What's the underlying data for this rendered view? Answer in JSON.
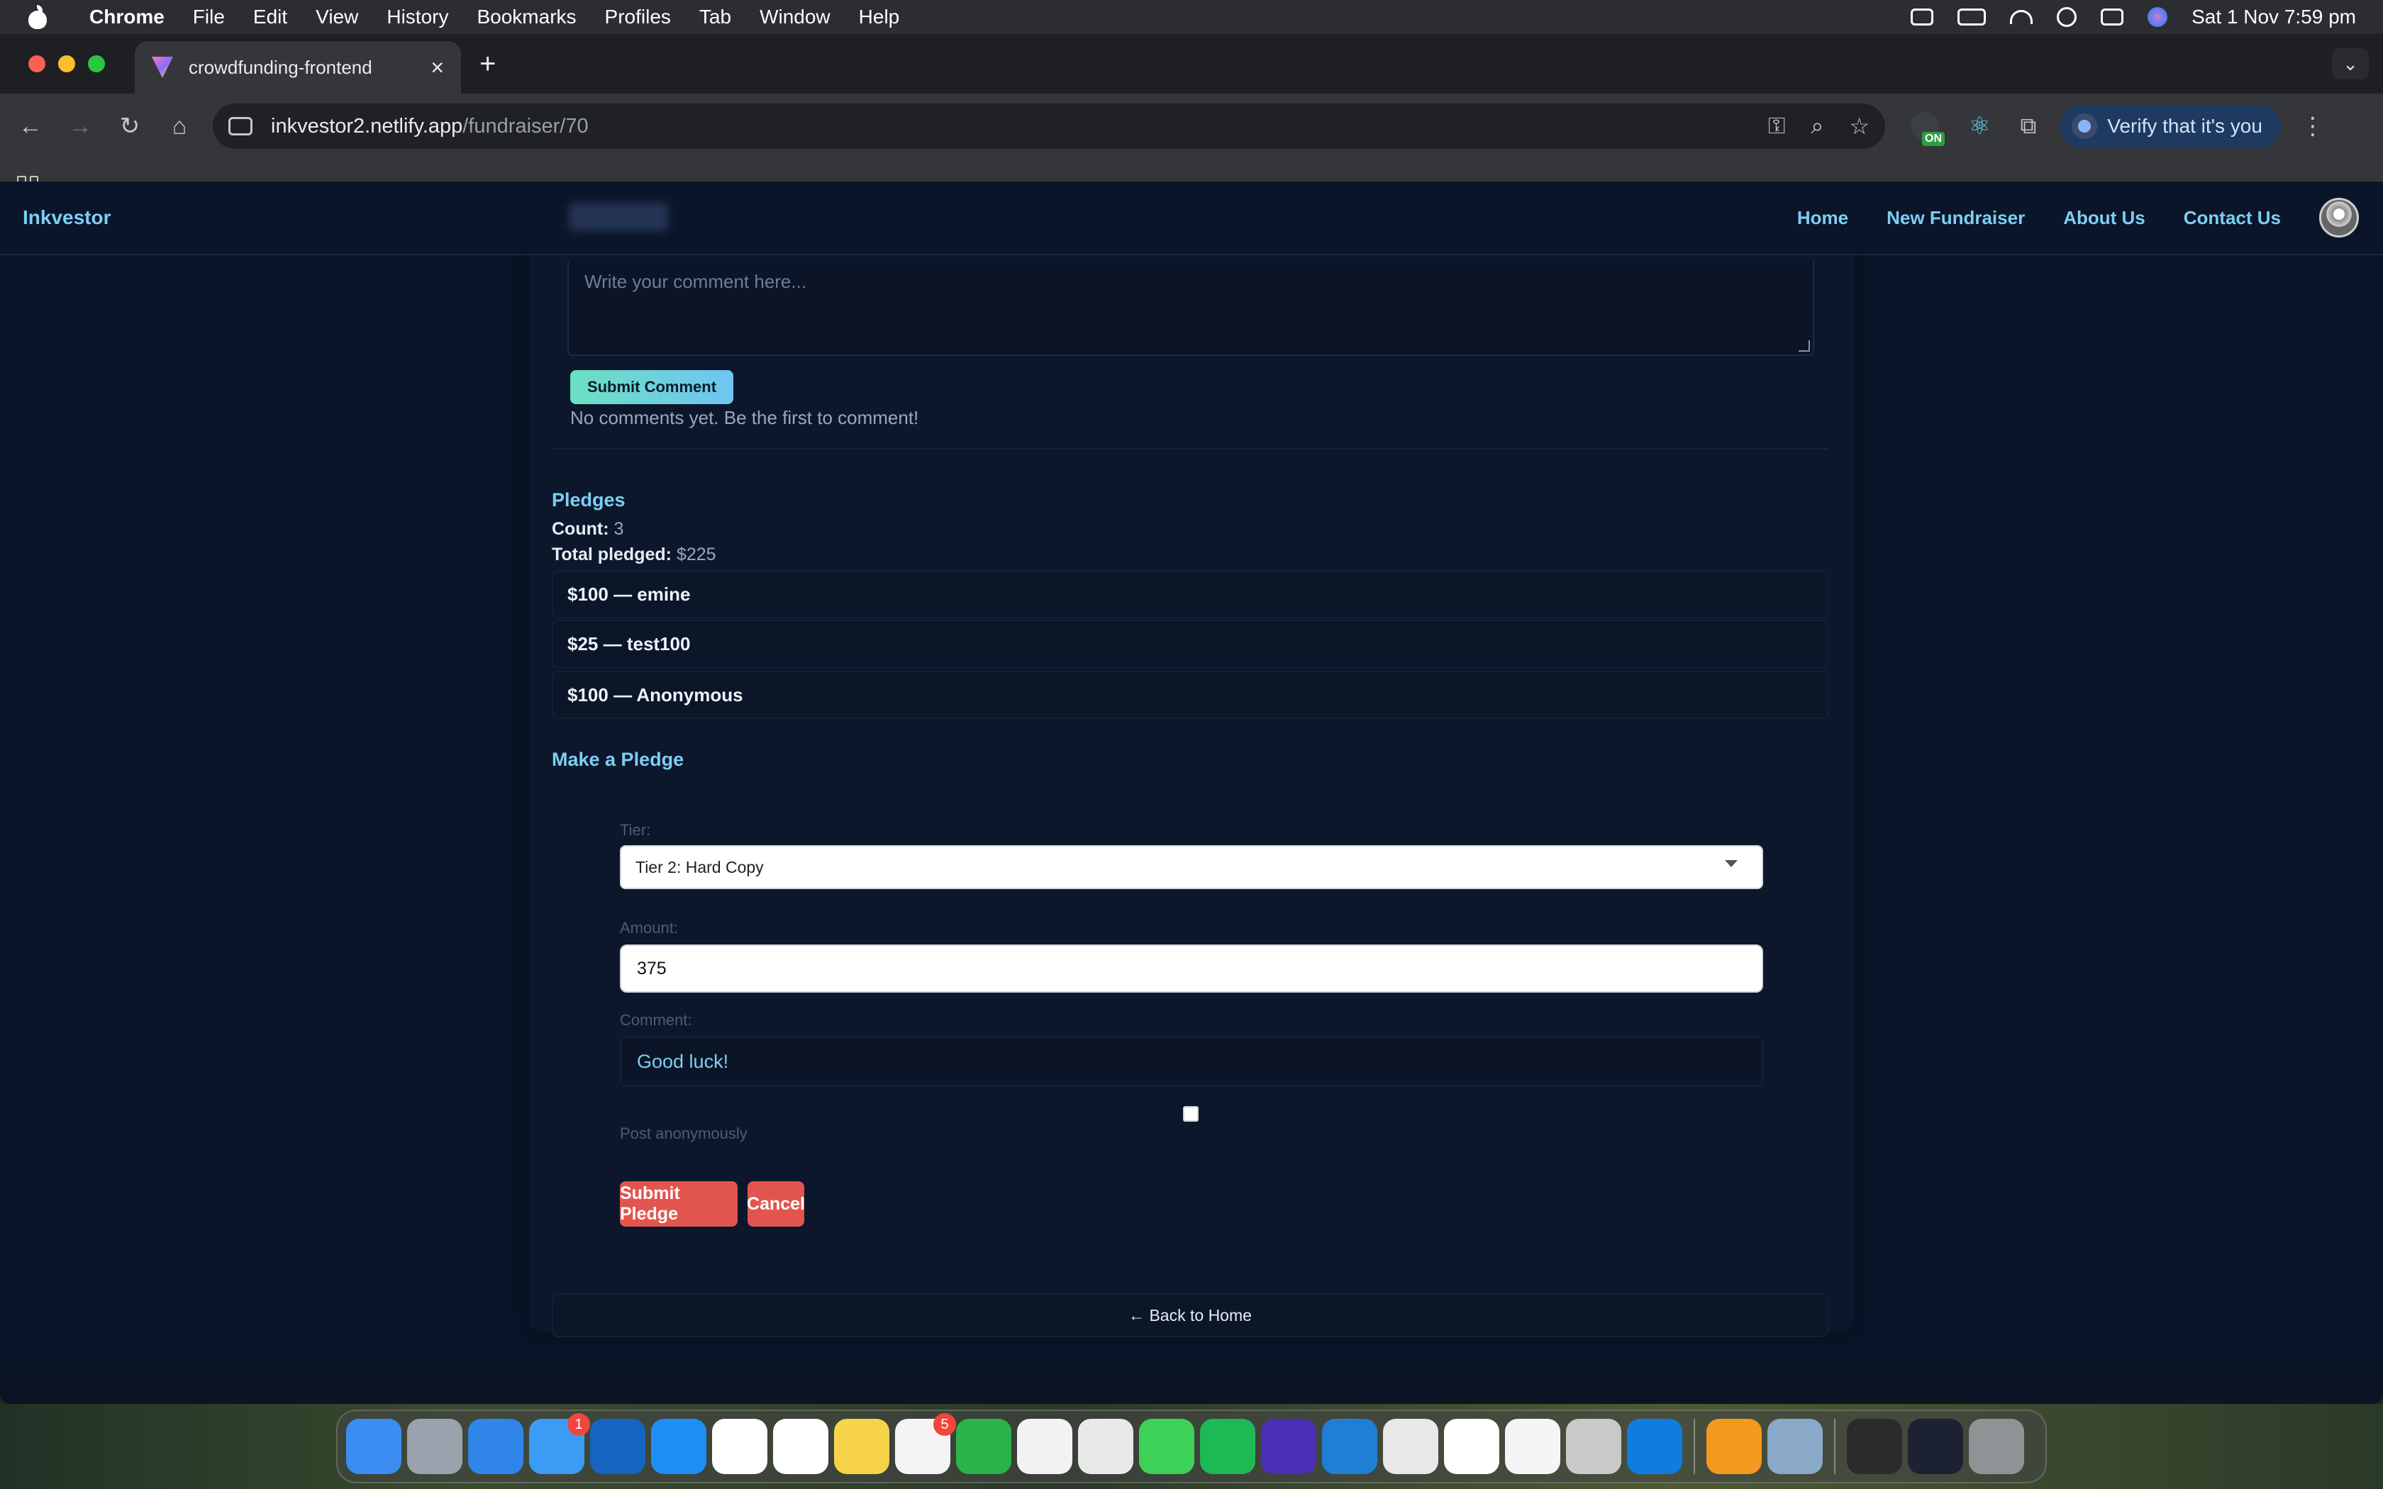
{
  "menubar": {
    "app_name": "Chrome",
    "items": [
      "File",
      "Edit",
      "View",
      "History",
      "Bookmarks",
      "Profiles",
      "Tab",
      "Window",
      "Help"
    ],
    "clock": "Sat 1 Nov  7:59 pm"
  },
  "browser": {
    "tab_title": "crowdfunding-frontend",
    "url_host": "inkvestor2.netlify.app",
    "url_path": "/fundraiser/70",
    "verify_label": "Verify that it's you",
    "extension_badge": "ON"
  },
  "site": {
    "brand": "Inkvestor",
    "nav": [
      "Home",
      "New Fundraiser",
      "About Us",
      "Contact Us"
    ]
  },
  "comments": {
    "placeholder": "Write your comment here...",
    "submit_label": "Submit Comment",
    "empty_message": "No comments yet. Be the first to comment!"
  },
  "pledges": {
    "title": "Pledges",
    "count_label": "Count:",
    "count_value": "3",
    "total_label": "Total pledged:",
    "total_value": "$225",
    "items": [
      "$100 — emine",
      "$25 — test100",
      "$100 — Anonymous"
    ]
  },
  "pledge_form": {
    "title": "Make a Pledge",
    "tier_label": "Tier:",
    "tier_value": "Tier 2: Hard Copy",
    "amount_label": "Amount:",
    "amount_value": "375",
    "comment_label": "Comment:",
    "comment_value": "Good luck!",
    "anonymous_label": "Post anonymously",
    "submit_label": "Submit Pledge",
    "cancel_label": "Cancel"
  },
  "back_home": "← Back to Home",
  "dock": {
    "apps": [
      {
        "name": "finder",
        "color": "#3b8df1"
      },
      {
        "name": "launchpad",
        "color": "#9aa3ad"
      },
      {
        "name": "safari",
        "color": "#2f86e8"
      },
      {
        "name": "mail",
        "color": "#3a9cf4",
        "badge": "1"
      },
      {
        "name": "outlook",
        "color": "#1565c0"
      },
      {
        "name": "app-store",
        "color": "#1e8ef7"
      },
      {
        "name": "notion",
        "color": "#ffffff"
      },
      {
        "name": "calendar",
        "color": "#ffffff"
      },
      {
        "name": "notes",
        "color": "#f7d34a"
      },
      {
        "name": "reminders",
        "color": "#f4f4f4",
        "badge": "5"
      },
      {
        "name": "numbers",
        "color": "#2bb34a"
      },
      {
        "name": "photos",
        "color": "#f2f2f2"
      },
      {
        "name": "chrome",
        "color": "#e9e9e9"
      },
      {
        "name": "messages",
        "color": "#3ed158"
      },
      {
        "name": "spotify",
        "color": "#1db954"
      },
      {
        "name": "orion",
        "color": "#4b2fb6"
      },
      {
        "name": "vscode",
        "color": "#1f7fd4"
      },
      {
        "name": "scope",
        "color": "#e8e8e8"
      },
      {
        "name": "slack",
        "color": "#ffffff"
      },
      {
        "name": "google-drive",
        "color": "#f5f5f5"
      },
      {
        "name": "simulator",
        "color": "#c9c9c9"
      },
      {
        "name": "windows-app",
        "color": "#0f7de0"
      },
      {
        "name": "pages",
        "color": "#f39a1e"
      },
      {
        "name": "preview",
        "color": "#8aa9c8"
      },
      {
        "name": "window-stack-1",
        "color": "#2b2b2b"
      },
      {
        "name": "window-stack-2",
        "color": "#1c2233"
      },
      {
        "name": "trash",
        "color": "#8f9396"
      }
    ]
  }
}
